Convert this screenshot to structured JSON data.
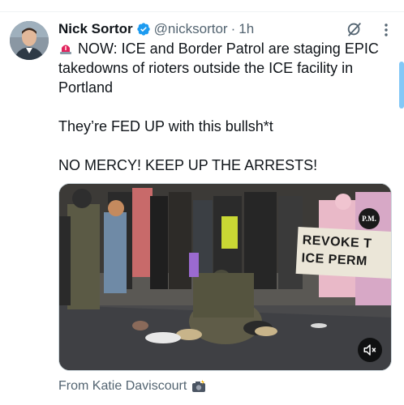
{
  "tweet": {
    "author_name": "Nick Sortor",
    "handle": "@nicksortor",
    "separator": "·",
    "time": "1h",
    "line1": "NOW: ICE and Border Patrol are staging EPIC takedowns of rioters outside the ICE facility in Portland",
    "line2": "They’re FED UP with this bullsh*t",
    "line3": "NO MERCY! KEEP UP THE ARRESTS!",
    "siren_icon": "rotating-light-emoji",
    "verified_color": "#1d9bf0"
  },
  "media": {
    "watermark": "P.M.",
    "sign_line1": "REVOKE T",
    "sign_line2": "ICE PERM",
    "mute_icon": "speaker-muted-icon"
  },
  "credit": {
    "text": "From Katie Daviscourt",
    "icon": "camera-with-flash-emoji"
  }
}
